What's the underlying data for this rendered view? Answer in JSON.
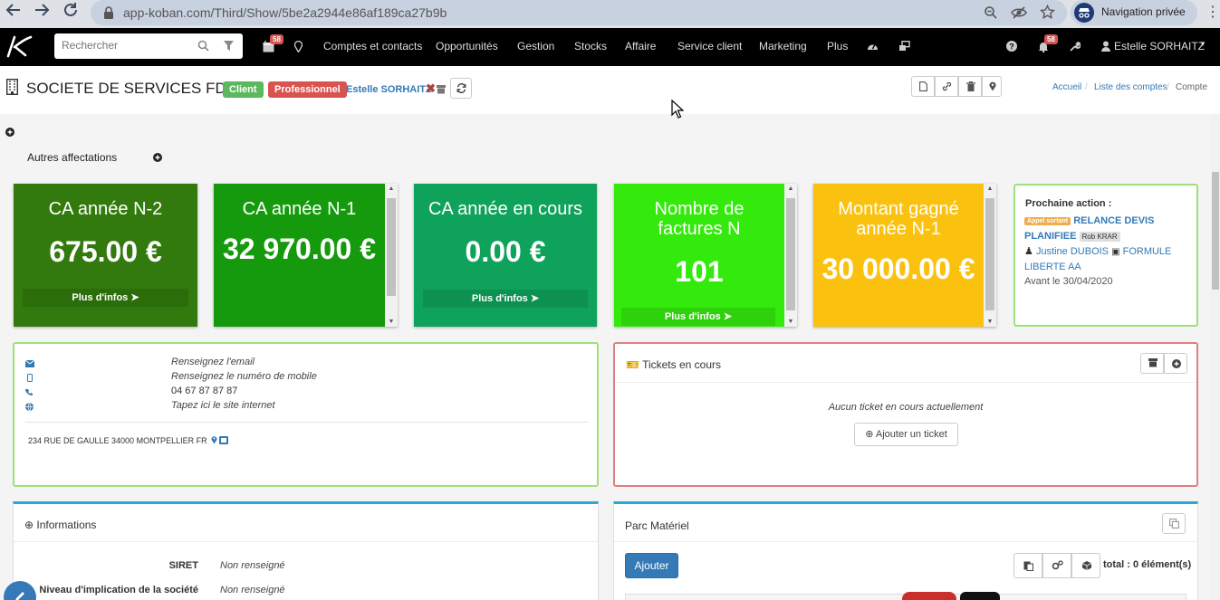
{
  "browser": {
    "url": "app-koban.com/Third/Show/5be2a2944e86af189ca27b9b",
    "private_label": "Navigation privée"
  },
  "topnav": {
    "search_placeholder": "Rechercher",
    "calendar_badge": "58",
    "notif_badge": "58",
    "items": [
      "Comptes et contacts",
      "Opportunités",
      "Gestion",
      "Stocks",
      "Affaire",
      "Service client",
      "Marketing",
      "Plus"
    ],
    "user": "Estelle SORHAITZ"
  },
  "header": {
    "company": "SOCIETE DE SERVICES FDR",
    "tag_client": "Client",
    "tag_pro": "Professionnel",
    "owner": "Estelle SORHAITZ",
    "breadcrumb": [
      "Accueil",
      "Liste des comptes",
      "Compte"
    ]
  },
  "affectations": {
    "label": "Autres affectations"
  },
  "kpis": [
    {
      "title": "CA année N-2",
      "value": "675.00 €",
      "more": "Plus d'infos",
      "color": "#327a0d"
    },
    {
      "title": "CA année N-1",
      "value": "32 970.00 €",
      "more": "",
      "color": "#159a0d"
    },
    {
      "title": "CA année en cours",
      "value": "0.00 €",
      "more": "Plus d'infos",
      "color": "#0fa25a"
    },
    {
      "title": "Nombre de factures N",
      "value": "101",
      "more": "Plus d'infos",
      "color": "#33ea0c"
    },
    {
      "title": "Montant gagné année N-1",
      "value": "30 000.00 €",
      "more": "",
      "color": "#fbc10f"
    }
  ],
  "next_action": {
    "title": "Prochaine action :",
    "tag": "Appel sortant",
    "label": "RELANCE DEVIS PLANIFIEE",
    "user_tag": "Rob KRAR",
    "contact": "Justine DUBOIS",
    "offer": "FORMULE LIBERTE AA",
    "date": "Avant le 30/04/2020"
  },
  "contact": {
    "email": "Renseignez l'email",
    "mobile": "Renseignez le numéro de mobile",
    "phone": "04 67 87 87 87",
    "website": "Tapez ici le site internet",
    "address": "234 RUE DE GAULLE 34000 MONTPELLIER FR"
  },
  "tickets": {
    "title": "Tickets en cours",
    "empty": "Aucun ticket en cours actuellement",
    "add_label": "Ajouter un ticket"
  },
  "informations": {
    "title": "Informations",
    "rows": [
      {
        "label": "SIRET",
        "value": "Non renseigné"
      },
      {
        "label": "Niveau d'implication de la société",
        "value": "Non renseigné"
      }
    ]
  },
  "parc": {
    "title": "Parc Matériel",
    "add_label": "Ajouter",
    "total": "total : 0 élément(s)"
  }
}
